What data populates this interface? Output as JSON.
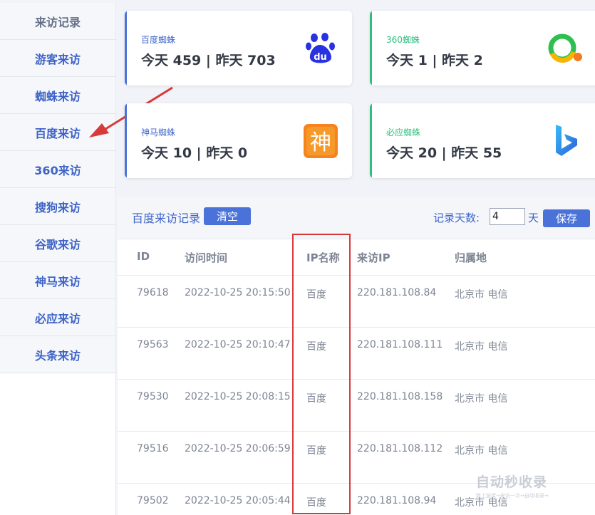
{
  "sidebar": {
    "items": [
      {
        "label": "来访记录"
      },
      {
        "label": "游客来访"
      },
      {
        "label": "蜘蛛来访"
      },
      {
        "label": "百度来访"
      },
      {
        "label": "360来访"
      },
      {
        "label": "搜狗来访"
      },
      {
        "label": "谷歌来访"
      },
      {
        "label": "神马来访"
      },
      {
        "label": "必应来访"
      },
      {
        "label": "头条来访"
      }
    ]
  },
  "cards": {
    "baidu": {
      "label": "百度蜘蛛",
      "stats": "今天 459 | 昨天 703",
      "accent": "#4a72d8",
      "icon_text": "du"
    },
    "so360": {
      "label": "360蜘蛛",
      "stats": "今天 1 | 昨天 2",
      "accent": "#2ebf7d"
    },
    "shenma": {
      "label": "神马蜘蛛",
      "stats": "今天 10 | 昨天 0",
      "accent": "#4a72d8",
      "icon_text": "神"
    },
    "bing": {
      "label": "必应蜘蛛",
      "stats": "今天 20 | 昨天 55",
      "accent": "#2ebf7d"
    }
  },
  "panel": {
    "title": "百度来访记录",
    "clear_label": "清空",
    "days_label": "记录天数:",
    "days_value": "4",
    "days_unit": "天",
    "save_label": "保存"
  },
  "table": {
    "headers": [
      "ID",
      "访问时间",
      "IP名称",
      "来访IP",
      "归属地"
    ],
    "rows": [
      [
        "79618",
        "2022-10-25 20:15:50",
        "百度",
        "220.181.108.84",
        "北京市 电信"
      ],
      [
        "79563",
        "2022-10-25 20:10:47",
        "百度",
        "220.181.108.111",
        "北京市 电信"
      ],
      [
        "79530",
        "2022-10-25 20:08:15",
        "百度",
        "220.181.108.158",
        "北京市 电信"
      ],
      [
        "79516",
        "2022-10-25 20:06:59",
        "百度",
        "220.181.108.112",
        "北京市 电信"
      ],
      [
        "79502",
        "2022-10-25 20:05:44",
        "百度",
        "220.181.108.94",
        "北京市 电信"
      ]
    ]
  },
  "watermark": {
    "text": "自动秒收录",
    "sub": "数上链接→来访一次→自动收录→"
  },
  "colors": {
    "primary": "#4a72d8",
    "green": "#2ebf7d",
    "annotation_red": "#d83a3a"
  }
}
